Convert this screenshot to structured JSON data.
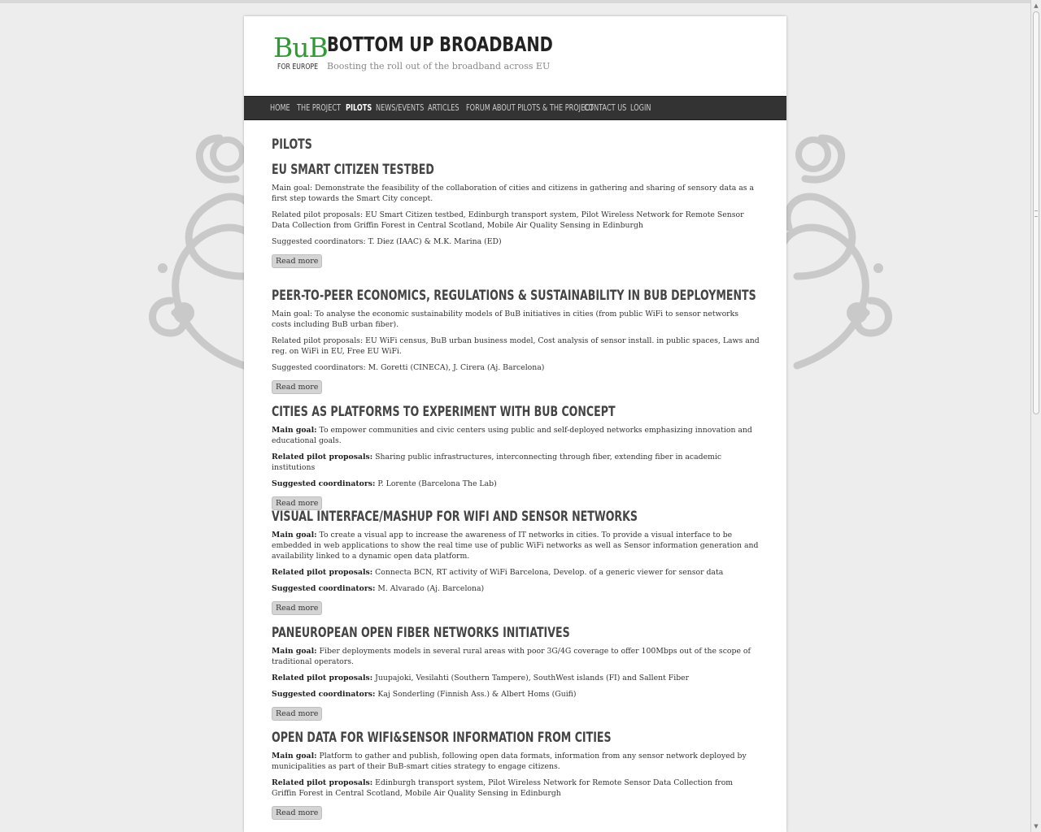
{
  "site": {
    "logo_text": "BuB",
    "logo_sub": "FOR EUROPE",
    "title": "BOTTOM UP BROADBAND",
    "tagline": "Boosting the roll out of the broadband across EU"
  },
  "nav": [
    {
      "label": "Home",
      "active": false
    },
    {
      "label": "The project",
      "active": false
    },
    {
      "label": "Pilots",
      "active": true
    },
    {
      "label": "News/Events",
      "active": false
    },
    {
      "label": "Articles",
      "active": false
    },
    {
      "label": "Forum about pilots & the project",
      "active": false
    },
    {
      "label": "Contact us",
      "active": false
    },
    {
      "label": "Login",
      "active": false
    }
  ],
  "page_title": "PILOTS",
  "read_more": "Read more",
  "pilots": [
    {
      "title": "EU SMART CITIZEN TESTBED",
      "goal_label": "Main goal:",
      "goal": "Demonstrate the feasibility of the collaboration of cities and citizens in gathering and sharing of sensory data as a first step towards the Smart City concept.",
      "proposals_label": "Related pilot proposals:",
      "proposals": "EU Smart Citizen testbed, Edinburgh transport system, Pilot Wireless Network for Remote Sensor Data Collection from Griffin Forest in Central Scotland, Mobile Air Quality Sensing in Edinburgh",
      "coordinators_label": "Suggested coordinators:",
      "coordinators": "T. Diez (IAAC) & M.K. Marina (ED)"
    },
    {
      "title": "PEER-TO-PEER ECONOMICS, REGULATIONS & SUSTAINABILITY IN BUB DEPLOYMENTS",
      "goal_label": "Main goal:",
      "goal": "To analyse the economic sustainability models of BuB initiatives in cities (from public WiFi to sensor networks costs including BuB urban fiber).",
      "proposals_label": "Related pilot proposals:",
      "proposals": "EU WiFi census, BuB urban business model, Cost analysis of sensor install. in public spaces, Laws and reg. on WiFi in EU, Free EU WiFi.",
      "coordinators_label": "Suggested coordinators:",
      "coordinators": "M. Goretti (CINECA), J. Cirera (Aj. Barcelona)"
    },
    {
      "title": "CITIES AS PLATFORMS TO EXPERIMENT WITH BUB CONCEPT",
      "goal_label": "Main goal:",
      "goal": "To empower communities and civic centers using public and self-deployed networks emphasizing innovation and educational goals.",
      "proposals_label": "Related pilot proposals:",
      "proposals": "Sharing public infrastructures, interconnecting through fiber, extending fiber in academic institutions",
      "coordinators_label": "Suggested coordinators:",
      "coordinators": "P. Lorente (Barcelona The Lab)"
    },
    {
      "title": "VISUAL INTERFACE/MASHUP FOR WIFI AND SENSOR NETWORKS",
      "goal_label": "Main goal:",
      "goal": "To create a visual app to increase the awareness of IT networks in cities. To provide a visual interface to be embedded in web applications to show the real time use of public WiFi networks as well as Sensor information generation and availability linked to a dynamic open data platform.",
      "proposals_label": "Related pilot proposals:",
      "proposals": "Connecta BCN, RT activity of WiFi Barcelona, Develop. of a generic viewer for sensor data",
      "coordinators_label": "Suggested coordinators:",
      "coordinators": "M. Alvarado (Aj. Barcelona)"
    },
    {
      "title": "PANEUROPEAN OPEN FIBER NETWORKS INITIATIVES",
      "goal_label": "Main goal:",
      "goal": "Fiber deployments models in several rural areas with poor 3G/4G coverage to offer 100Mbps out of the scope of traditional operators.",
      "proposals_label": "Related pilot proposals:",
      "proposals": "Juupajoki, Vesilahti (Southern Tampere), SouthWest islands (FI) and Sallent Fiber",
      "coordinators_label": "Suggested coordinators:",
      "coordinators": "Kaj Sonderling (Finnish Ass.) & Albert Homs (Guifi)"
    },
    {
      "title": "OPEN DATA FOR WIFI&SENSOR INFORMATION FROM CITIES",
      "goal_label": "Main goal:",
      "goal": "Platform to gather and publish, following open data formats, information from any sensor network deployed by municipalities as part of their BuB-smart cities strategy to engage citizens.",
      "proposals_label": "Related pilot proposals:",
      "proposals": "Edinburgh transport system, Pilot Wireless Network for Remote Sensor Data Collection from Griffin Forest in Central Scotland, Mobile Air Quality Sensing in Edinburgh",
      "coordinators_label": "",
      "coordinators": ""
    }
  ],
  "colors": {
    "background": "#ededed",
    "nav_bg": "#333333",
    "logo_green": "#2e9a35",
    "button_bg": "#d4d4d4"
  }
}
